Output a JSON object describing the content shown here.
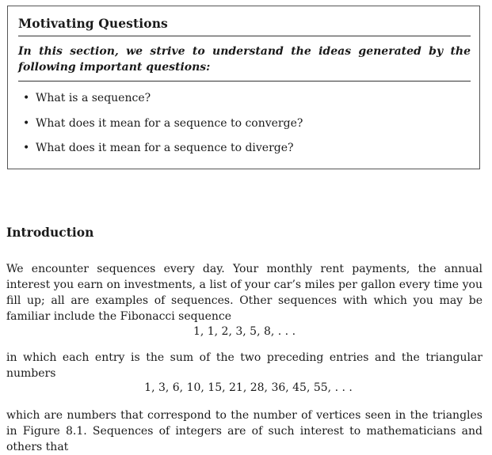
{
  "motivating_questions": {
    "title": "Motivating Questions",
    "intro": "In this section, we strive to understand the ideas generated by the following important questions:",
    "items": [
      {
        "bullet": "•",
        "text": "What is a sequence?"
      },
      {
        "bullet": "•",
        "text": "What does it mean for a sequence to converge?"
      },
      {
        "bullet": "•",
        "text": "What does it mean for a sequence to diverge?"
      }
    ]
  },
  "introduction": {
    "heading": "Introduction",
    "paragraph1": "We encounter sequences every day. Your monthly rent payments, the annual interest you earn on investments, a list of your car’s miles per gallon every time you fill up; all are examples of sequences.  Other sequences with which you may be familiar include the Fibonacci sequence",
    "fibonacci": "1, 1, 2, 3, 5, 8, . . .",
    "paragraph2": "in which each entry is the sum of the two preceding entries and the triangular numbers",
    "triangular": "1, 3, 6, 10, 15, 21, 28, 36, 45, 55, . . .",
    "paragraph3": "which are numbers that correspond to the number of vertices seen in the triangles in Figure 8.1. Sequences of integers are of such interest to mathematicians and others that"
  }
}
